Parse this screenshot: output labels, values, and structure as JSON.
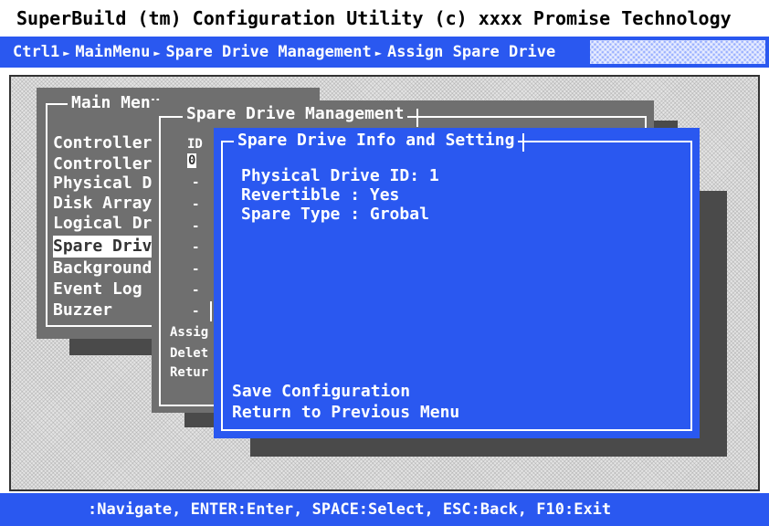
{
  "window": {
    "title": "SuperBuild (tm) Configuration Utility (c) xxxx Promise Technology"
  },
  "breadcrumb": {
    "items": [
      "Ctrl1",
      "MainMenu",
      "Spare Drive Management",
      "Assign Spare Drive"
    ],
    "separator": "►"
  },
  "main_menu": {
    "title": "Main Menu",
    "items": [
      "Controller",
      "Controller",
      "Physical D",
      "Disk Array",
      "Logical Dr",
      "Spare Driv",
      "Background",
      "Event Log",
      "Buzzer"
    ],
    "selected_index": 5
  },
  "spare_drive_management": {
    "title": "Spare Drive Management",
    "column_header": "ID",
    "ids": [
      "0",
      "-",
      "-",
      "-",
      "-",
      "-",
      "-",
      "-"
    ],
    "actions": [
      "Assig",
      "Delet",
      "Retur"
    ]
  },
  "spare_info": {
    "title": "Spare Drive Info and Setting",
    "physical_drive_id": "Physical Drive ID: 1",
    "revertible": "Revertible : Yes",
    "spare_type": "Spare Type : Grobal",
    "save_label": "Save Configuration",
    "return_label": "Return to Previous Menu"
  },
  "status_bar": {
    "text": ":Navigate, ENTER:Enter, SPACE:Select, ESC:Back, F10:Exit"
  },
  "colors": {
    "accent": "#2a58f0",
    "panel_gray": "#6f6f6f",
    "shadow": "#4a4a4a"
  }
}
